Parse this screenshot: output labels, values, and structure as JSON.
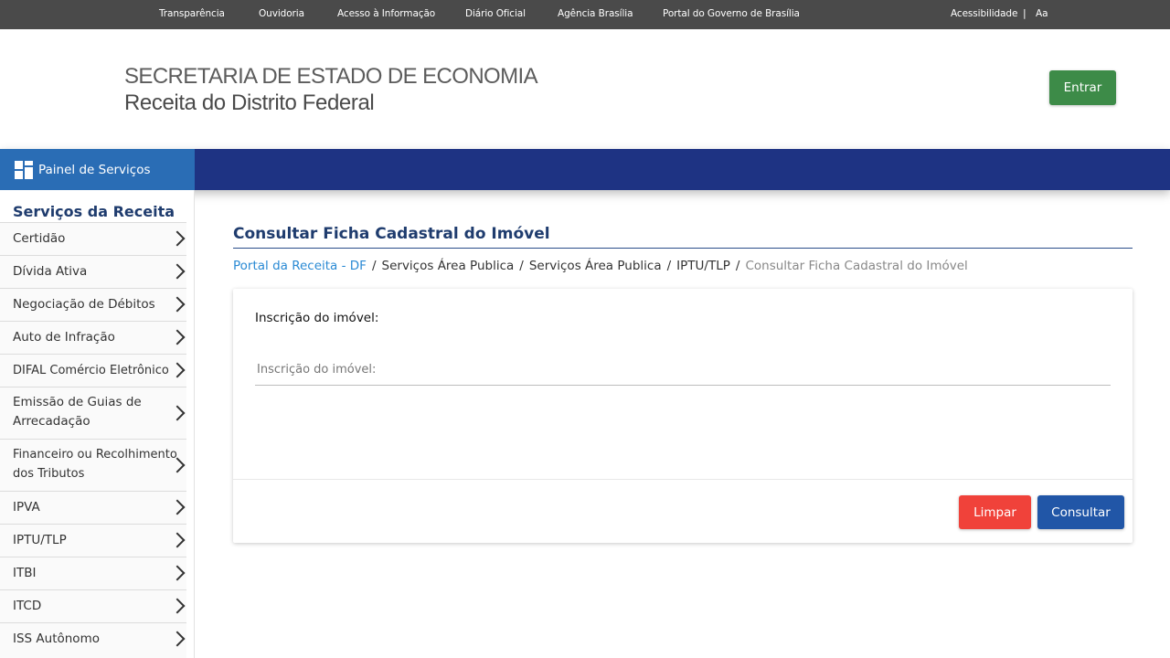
{
  "topbar": {
    "links": [
      "Transparência",
      "Ouvidoria",
      "Acesso à Informação",
      "Diário Oficial",
      "Agência Brasília",
      "Portal do Governo de Brasília"
    ],
    "accessibility": "Acessibilidade",
    "separator": "|",
    "font_size": "Aa"
  },
  "header": {
    "line1": "SECRETARIA DE ESTADO DE ECONOMIA",
    "line2": "Receita do Distrito Federal",
    "login_label": "Entrar"
  },
  "band": {
    "panel_label": "Painel de Serviços",
    "panel_icon": "grid-icon"
  },
  "sidebar": {
    "title": "Serviços da Receita",
    "items": [
      {
        "label": "Certidão"
      },
      {
        "label": "Dívida Ativa"
      },
      {
        "label": "Negociação de Débitos"
      },
      {
        "label": "Auto de Infração"
      },
      {
        "label": "DIFAL Comércio Eletrônico"
      },
      {
        "label": "Emissão de Guias de Arrecadação"
      },
      {
        "label": "Financeiro ou Recolhimento dos Tributos"
      },
      {
        "label": "IPVA"
      },
      {
        "label": "IPTU/TLP"
      },
      {
        "label": "ITBI"
      },
      {
        "label": "ITCD"
      },
      {
        "label": "ISS Autônomo"
      }
    ]
  },
  "main": {
    "title": "Consultar Ficha Cadastral do Imóvel",
    "breadcrumb": [
      "Portal da Receita - DF",
      "Serviços Área Publica",
      "Serviços Área Publica",
      "IPTU/TLP",
      "Consultar Ficha Cadastral do Imóvel"
    ],
    "breadcrumb_separator": "/",
    "form": {
      "label": "Inscrição do imóvel:",
      "placeholder": "Inscrição do imóvel:",
      "value": ""
    },
    "buttons": {
      "clear": "Limpar",
      "submit": "Consultar"
    }
  },
  "colors": {
    "topbar": "#4a4a4a",
    "band": "#1e3383",
    "panel": "#2a6db5",
    "login_button": "#3d8b48",
    "clear_button": "#f0423a",
    "submit_button": "#2156a7",
    "title": "#1f3c6e",
    "breadcrumb_link": "#2a8ad4"
  }
}
